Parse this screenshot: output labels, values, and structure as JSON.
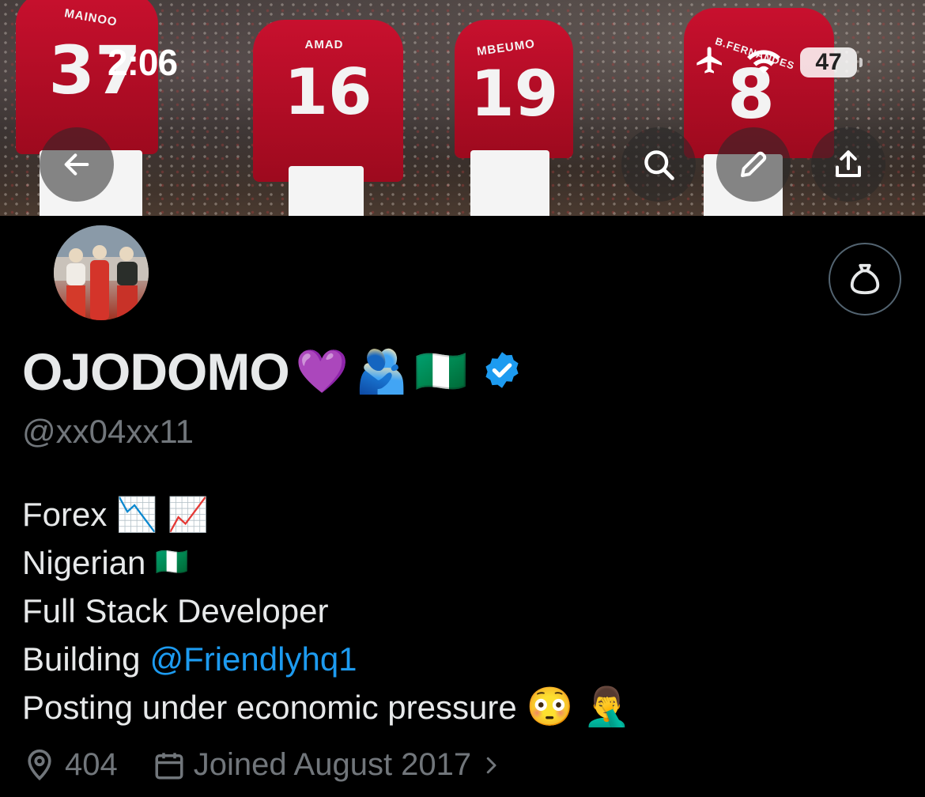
{
  "status_bar": {
    "time": "2:06",
    "battery": "47"
  },
  "banner": {
    "players": [
      {
        "name": "MAINOO",
        "number": "37"
      },
      {
        "name": "AMAD",
        "number": "16"
      },
      {
        "name": "MBEUMO",
        "number": "19"
      },
      {
        "name": "B.FERNANDES",
        "number": "8"
      }
    ]
  },
  "profile": {
    "display_name": "OJODOMO",
    "name_emojis": [
      "💜",
      "🫂",
      "🇳🇬"
    ],
    "handle": "@xx04xx11",
    "bio": {
      "line1": "Forex",
      "line1_emojis": [
        "📉",
        "📈"
      ],
      "line2": "Nigerian",
      "line2_emoji": "🇳🇬",
      "line3": "Full Stack Developer",
      "line4_prefix": "Building",
      "line4_link": "@Friendlyhq1",
      "line5": "Posting under economic pressure",
      "line5_emojis": [
        "😳",
        "🤦‍♂️"
      ]
    },
    "location": "404",
    "joined": "Joined August 2017"
  },
  "colors": {
    "accent": "#1d9bf0",
    "verified": "#1d9bf0",
    "muted": "#71767b",
    "background": "#000000"
  }
}
